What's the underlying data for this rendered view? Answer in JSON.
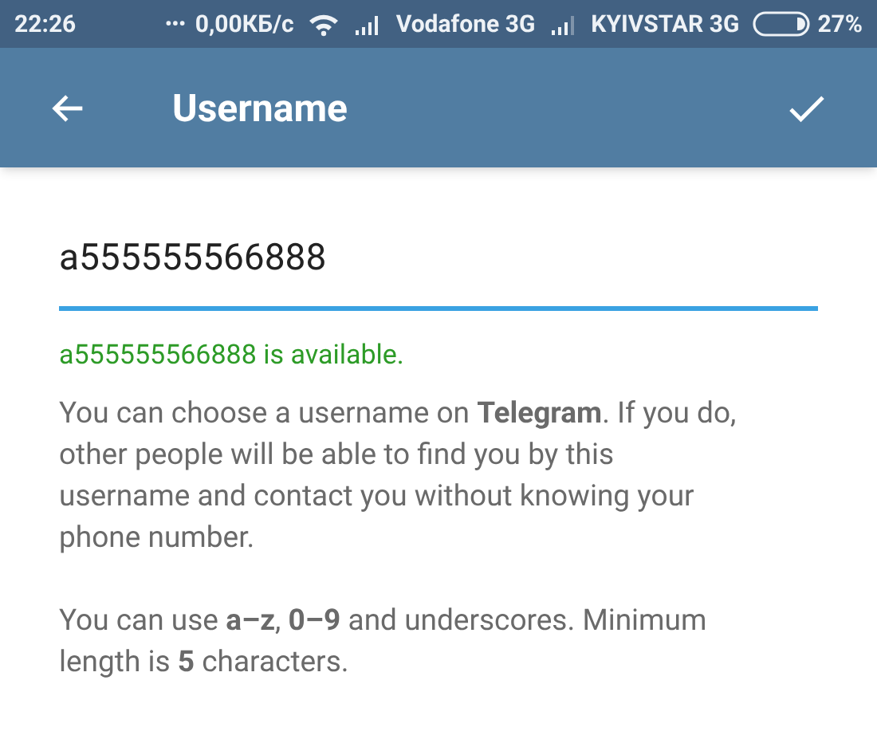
{
  "status_bar": {
    "time": "22:26",
    "dots": "•••",
    "speed": "0,00КБ/с",
    "carrier_1": "Vodafone 3G",
    "carrier_2": "KYIVSTAR 3G",
    "battery": "27%"
  },
  "app_bar": {
    "title": "Username"
  },
  "username_field": {
    "value": "a555555566888"
  },
  "availability": "a555555566888 is available.",
  "help": [
    "You can choose a username on **Telegram**. If you do, other people will be able to find you by this username and contact you without knowing your phone number.",
    "You can use **a–z**, **0–9** and underscores. Minimum length is **5** characters."
  ]
}
